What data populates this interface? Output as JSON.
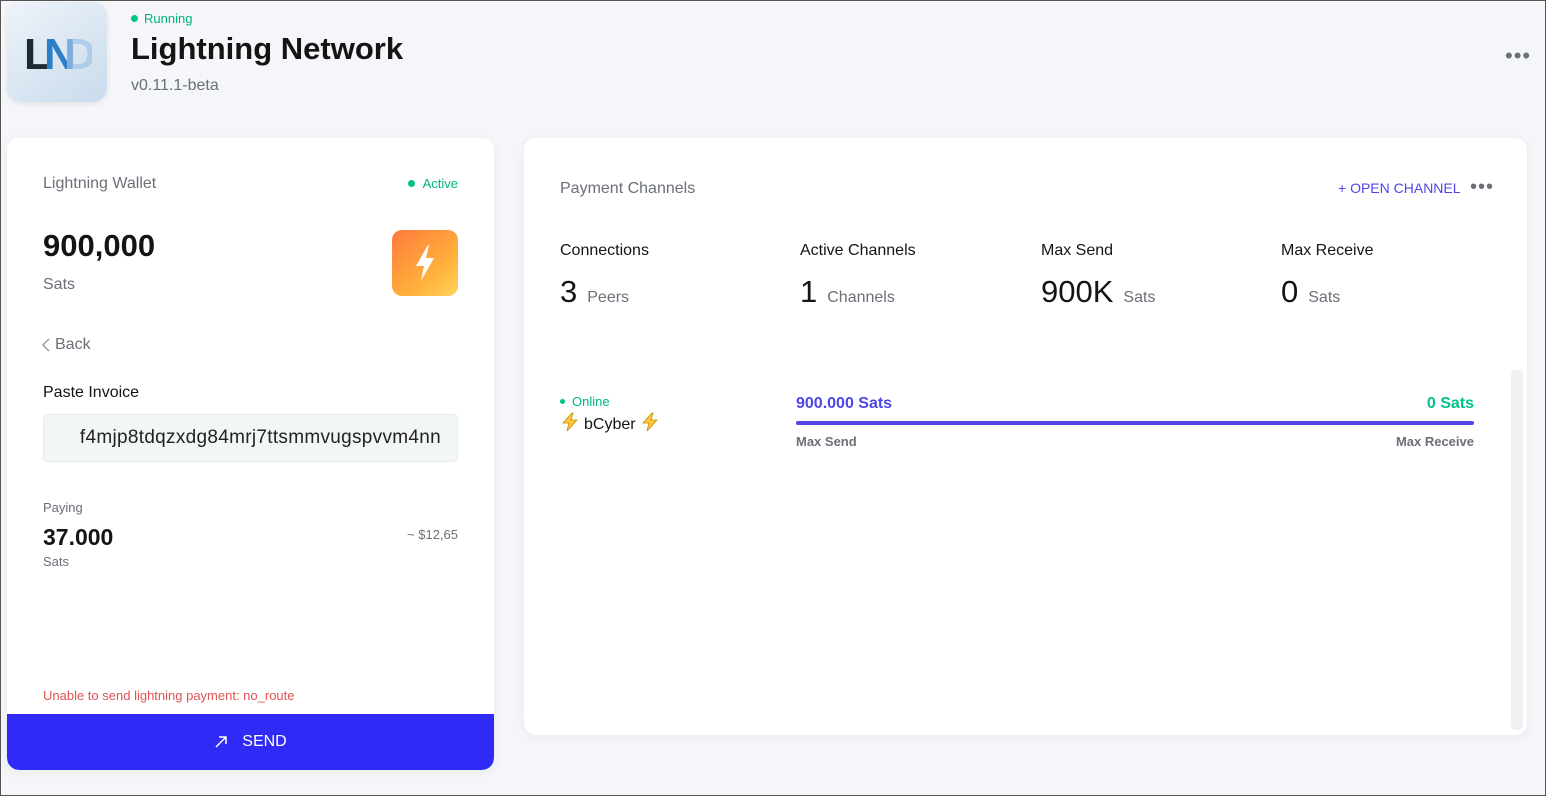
{
  "app": {
    "status": "Running",
    "title": "Lightning Network",
    "version": "v0.11.1-beta",
    "logo_text": "LND"
  },
  "wallet": {
    "title": "Lightning Wallet",
    "status": "Active",
    "balance": "900,000",
    "unit": "Sats",
    "back_label": "Back",
    "invoice_label": "Paste Invoice",
    "invoice_value": "f4mjp8tdqzxdg84mrj7ttsmmvugspvvm4nn",
    "paying_label": "Paying",
    "paying_amount": "37.000",
    "paying_unit": "Sats",
    "paying_fiat": "~ $12,65",
    "error": "Unable to send lightning payment: no_route",
    "send_label": "SEND"
  },
  "channels": {
    "title": "Payment Channels",
    "open_label": "+ OPEN CHANNEL",
    "stats": [
      {
        "label": "Connections",
        "value": "3",
        "unit": "Peers"
      },
      {
        "label": "Active Channels",
        "value": "1",
        "unit": "Channels"
      },
      {
        "label": "Max Send",
        "value": "900K",
        "unit": "Sats"
      },
      {
        "label": "Max Receive",
        "value": "0",
        "unit": "Sats"
      }
    ],
    "peer": {
      "status": "Online",
      "name": "bCyber",
      "send_value": "900.000 Sats",
      "receive_value": "0 Sats",
      "send_label": "Max Send",
      "receive_label": "Max Receive",
      "send_fraction": 1.0
    }
  },
  "colors": {
    "accent": "#4f46e5",
    "send_button": "#2f2af5",
    "online": "#00c28d",
    "error": "#e05353"
  }
}
